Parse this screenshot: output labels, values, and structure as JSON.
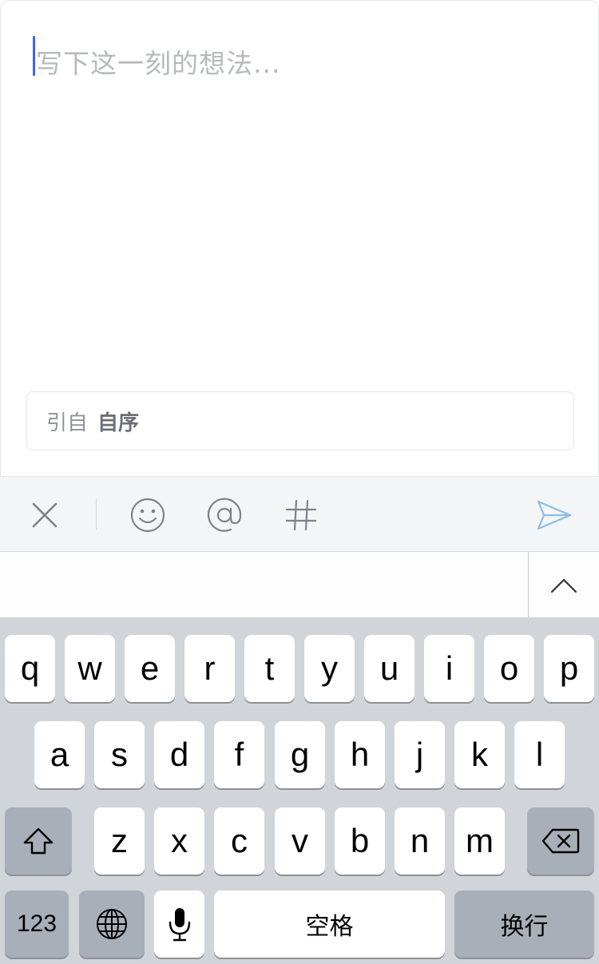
{
  "composer": {
    "placeholder": "写下这一刻的想法...",
    "quote_prefix": "引自",
    "quote_source": "自序"
  },
  "toolbar": {
    "icons": [
      "close-icon",
      "emoji-icon",
      "mention-icon",
      "hashtag-icon",
      "send-icon"
    ],
    "send_color": "#8bbcea"
  },
  "keyboard": {
    "row1": [
      "q",
      "w",
      "e",
      "r",
      "t",
      "y",
      "u",
      "i",
      "o",
      "p"
    ],
    "row2": [
      "a",
      "s",
      "d",
      "f",
      "g",
      "h",
      "j",
      "k",
      "l"
    ],
    "row3": [
      "z",
      "x",
      "c",
      "v",
      "b",
      "n",
      "m"
    ],
    "numbers_label": "123",
    "space_label": "空格",
    "return_label": "换行"
  }
}
